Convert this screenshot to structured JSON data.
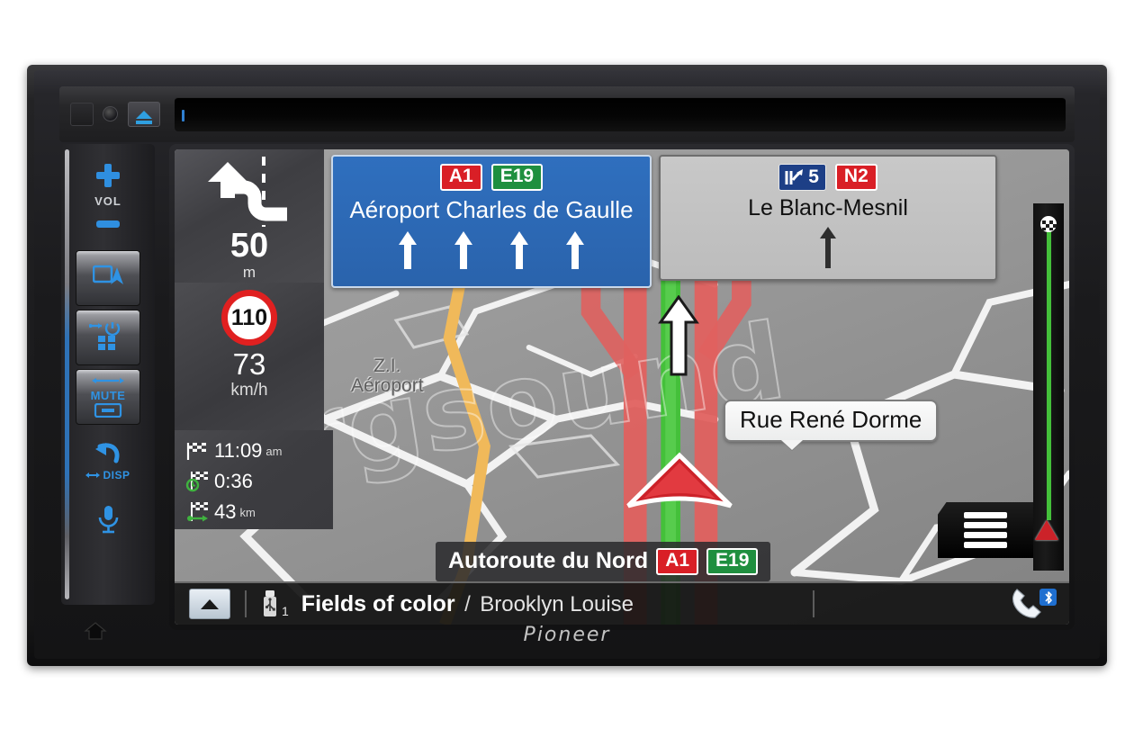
{
  "device": {
    "brand": "Pioneer",
    "top_controls": {
      "reset_slot": "reset-slot",
      "mic_hole": "microphone",
      "eject_label": "Eject",
      "disc_slot_label": "Disc slot"
    },
    "side_buttons": {
      "vol_label": "VOL",
      "vol_up": "Volume up",
      "vol_down": "Volume down",
      "map_button": "Map / Navigation",
      "apps_button": "Power / Apps",
      "mute_label": "MUTE",
      "disp_label": "DISP",
      "back_button": "Back",
      "voice_button": "Voice control",
      "home_button": "Home"
    }
  },
  "navigation": {
    "maneuver": {
      "icon": "lane-change-left-icon",
      "distance": "50",
      "unit": "m"
    },
    "speed": {
      "limit": "110",
      "current": "73",
      "unit": "km/h"
    },
    "trip": [
      {
        "icon": "checkered-flag-icon",
        "value": "11:09",
        "unit": "am"
      },
      {
        "icon": "checkered-flag-clock-icon",
        "value": "0:36",
        "unit": ""
      },
      {
        "icon": "checkered-flag-distance-icon",
        "value": "43",
        "unit": "km"
      }
    ],
    "sign_primary": {
      "text": "Aéroport Charles de Gaulle",
      "badges": [
        {
          "label": "A1",
          "color": "#d91f26"
        },
        {
          "label": "E19",
          "color": "#1f8f3f"
        }
      ],
      "lane_count": 4
    },
    "sign_secondary": {
      "text": "Le Blanc-Mesnil",
      "exit_number": "5",
      "badges": [
        {
          "label": "N2",
          "color": "#d91f26"
        }
      ]
    },
    "street_callout": "Rue René Dorme",
    "area_label_line1": "Z.I.",
    "area_label_line2": "Aéroport",
    "road_bar": {
      "name": "Autoroute du Nord",
      "badges": [
        {
          "label": "A1",
          "color": "#d91f26"
        },
        {
          "label": "E19",
          "color": "#1f8f3f"
        }
      ]
    },
    "menu_button": "menu-icon",
    "progress": {
      "destination_icon": "checkered-flag-icon",
      "position_icon": "position-arrow-icon"
    },
    "watermark": "rgsound",
    "colors": {
      "route": "#44c03a",
      "traffic": "#e0615f",
      "sign_blue": "#2f6fbe",
      "accent_blue": "#2f93e4"
    }
  },
  "media_bar": {
    "expand_button": "expand-icon",
    "source_icon": "usb-icon",
    "source_index": "1",
    "track_title": "Fields of color",
    "separator": "/",
    "track_artist": "Brooklyn Louise",
    "phone_icon": "phone-icon",
    "bluetooth_icon": "bluetooth-icon"
  }
}
